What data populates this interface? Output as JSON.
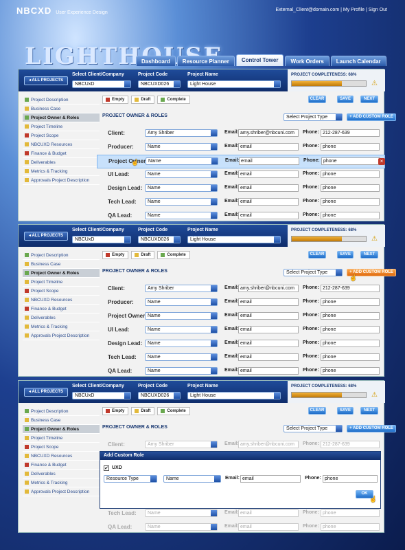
{
  "app": {
    "logo": "NBCXD",
    "logo_sub": "User Experience Design",
    "brand": "LIGHTHOUSE"
  },
  "toplinks": {
    "user": "External_Client@domain.com",
    "sep1": "|",
    "profile": "My Profile",
    "sep2": "|",
    "signout": "Sign Out"
  },
  "tabs": [
    "Dashboard",
    "Resource Planner",
    "Control Tower",
    "Work Orders",
    "Launch Calendar"
  ],
  "selectors": {
    "all_projects": "ALL PROJECTS",
    "client_label": "Select Client/Company",
    "client_value_1": "NBCUxD",
    "client_value_2": "NBCUxD",
    "client_value_3": "NBCUxD",
    "code_label": "Project Code",
    "code_value": "NBCUXD026",
    "name_label": "Project Name",
    "name_value": "Light House",
    "completeness_label": "PROJECT COMPLETENESS: 68%",
    "completeness_pct": 0.68
  },
  "sidebar": [
    "Project Description",
    "Business Case",
    "Project Owner & Roles",
    "Project Timeline",
    "Project Scope",
    "NBCUXD Resources",
    "Finance & Budget",
    "Deliverables",
    "Metrics & Tracking",
    "Approvals Project Description"
  ],
  "legend": {
    "empty": "Empty",
    "draft": "Draft",
    "complete": "Complete"
  },
  "buttons": {
    "clear": "CLEAR",
    "save": "SAVE",
    "next": "NEXT",
    "add_role": "ADD CUSTOM ROLE"
  },
  "section": {
    "title": "PROJECT OWNER & ROLES",
    "project_type": "Select Project Type"
  },
  "labels": {
    "email": "Email:",
    "phone": "Phone:"
  },
  "roles": [
    {
      "role": "Client:",
      "name": "Amy Shriber",
      "email": "amy.shriber@nbcuni.com",
      "phone": "212-287-639"
    },
    {
      "role": "Producer:",
      "name": "Name",
      "email": "email",
      "phone": "phone"
    },
    {
      "role": "Project Owner:",
      "name": "Name",
      "email": "email",
      "phone": "phone"
    },
    {
      "role": "UI Lead:",
      "name": "Name",
      "email": "email",
      "phone": "phone"
    },
    {
      "role": "Design Lead:",
      "name": "Name",
      "email": "email",
      "phone": "phone"
    },
    {
      "role": "Tech Lead:",
      "name": "Name",
      "email": "email",
      "phone": "phone"
    },
    {
      "role": "QA Lead:",
      "name": "Name",
      "email": "email",
      "phone": "phone"
    }
  ],
  "modal": {
    "title": "Add Custom Role",
    "check_label": "UXD",
    "resource_type": "Resource Type",
    "name": "Name",
    "email_label": "Email:",
    "email": "email",
    "phone_label": "Phone:",
    "phone": "phone",
    "ok": "OK",
    "tech_lead": "Tech Lead:",
    "qa_lead": "QA Lead:"
  },
  "colors": {
    "accent": "#1e6cc8",
    "header": "#0f2d6b",
    "progress": "#d99318",
    "empty": "#c0392b",
    "draft": "#e2b93b",
    "complete": "#6aa84f"
  }
}
